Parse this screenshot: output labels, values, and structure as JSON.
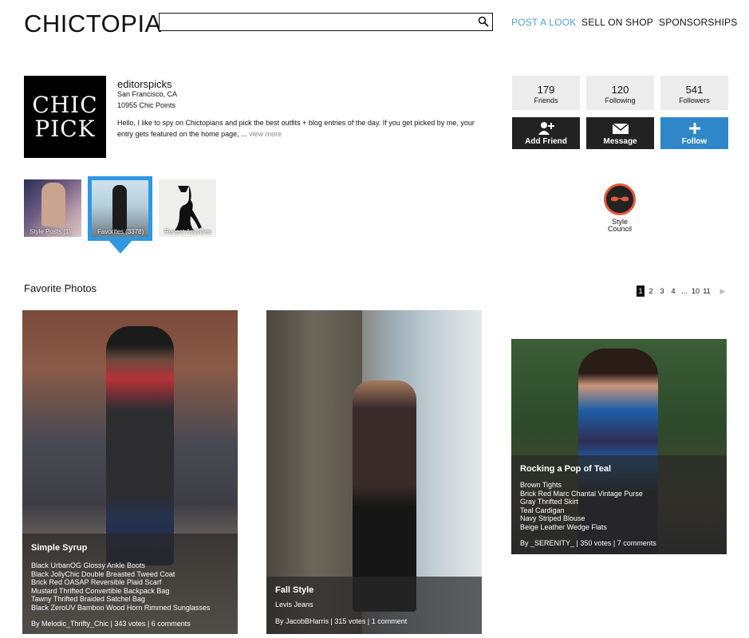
{
  "header": {
    "logo": "CHICTOPIA",
    "search_placeholder": "",
    "nav": [
      "POST A LOOK",
      "SELL ON SHOP",
      "SPONSORSHIPS"
    ],
    "nav_accent": "#4da6d6"
  },
  "profile": {
    "avatar_text_line1": "CHIC",
    "avatar_text_line2": "PICK",
    "username": "editorspicks",
    "location": "San Francisco, CA",
    "points": "10955 Chic Points",
    "bio": "Hello, I like to spy on Chictopians and pick the best outfits + blog entries of the day. If you get picked by me, your entry gets featured on the home page, ...",
    "view_more": "view more",
    "stats": [
      {
        "num": "179",
        "label": "Friends"
      },
      {
        "num": "120",
        "label": "Following"
      },
      {
        "num": "541",
        "label": "Followers"
      }
    ],
    "actions": [
      {
        "label": "Add Friend",
        "icon": "add-person-icon"
      },
      {
        "label": "Message",
        "icon": "envelope-icon"
      },
      {
        "label": "Follow",
        "icon": "plus-icon"
      }
    ],
    "follow_color": "#2f86c9"
  },
  "tabs": [
    {
      "label": "Style Posts (1)"
    },
    {
      "label": "Favorites (3378)",
      "selected": true
    },
    {
      "label": "Recent Activities"
    }
  ],
  "badge": {
    "label_line1": "Style",
    "label_line2": "Council",
    "icon": "sunglasses-icon"
  },
  "favorites": {
    "title": "Favorite Photos",
    "pager": [
      "1",
      "2",
      "3",
      "4",
      "...",
      "10",
      "11"
    ],
    "current_page": "1",
    "cards": [
      {
        "title": "Simple Syrup",
        "items": [
          "Black UrbanOG Glossy Ankle Boots",
          "Black JollyChic Double Breasted Tweed Coat",
          "Brick Red OASAP Reversible Plaid Scarf",
          "Mustard Thrifted Convertible Backpack Bag",
          "Tawny Thrifted Braided Satchel Bag",
          "Black ZeroUV Bamboo Wood Horn Rimmed Sunglasses"
        ],
        "byline": "By Melodic_Thrifty_Chic | 343 votes | 6 comments"
      },
      {
        "title": "Fall Style",
        "items": [
          "Levis Jeans"
        ],
        "byline": "By JacobBHarris | 315 votes | 1 comment"
      },
      {
        "title": "Rocking a Pop of Teal",
        "items": [
          "Brown Tights",
          "Brick Red Marc Chantal Vintage Purse",
          "Gray Thrifted Skirt",
          "Teal Cardigan",
          "Navy Striped Blouse",
          "Beige Leather Wedge Flats"
        ],
        "byline": "By _SERENITY_ | 350 votes | 7 comments"
      }
    ]
  }
}
